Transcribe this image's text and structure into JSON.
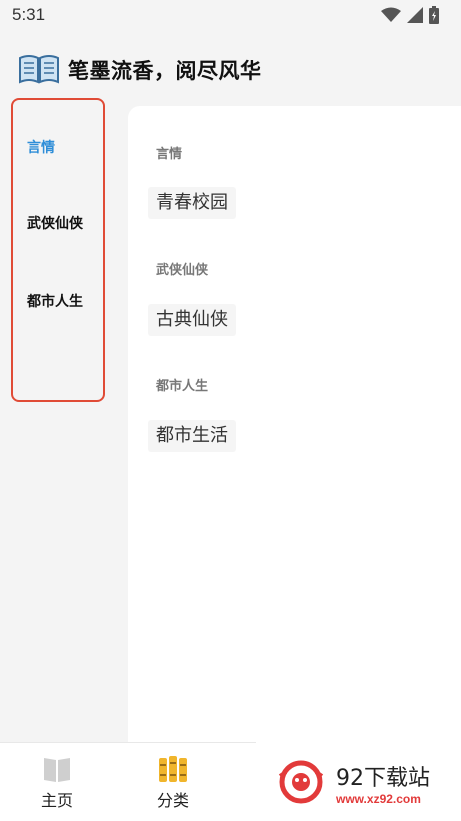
{
  "status_bar": {
    "time": "5:31"
  },
  "header": {
    "title": "笔墨流香，阅尽风华"
  },
  "sidebar": {
    "items": [
      {
        "label": "言情",
        "active": true
      },
      {
        "label": "武侠仙侠",
        "active": false
      },
      {
        "label": "都市人生",
        "active": false
      }
    ]
  },
  "content": {
    "sections": [
      {
        "title": "言情",
        "tags": [
          "青春校园"
        ]
      },
      {
        "title": "武侠仙侠",
        "tags": [
          "古典仙侠"
        ]
      },
      {
        "title": "都市人生",
        "tags": [
          "都市生活"
        ]
      }
    ]
  },
  "tabbar": {
    "tabs": [
      {
        "label": "主页",
        "icon": "book-icon"
      },
      {
        "label": "分类",
        "icon": "category-icon"
      }
    ]
  },
  "watermark": {
    "title": "92下载站",
    "url": "www.xz92.com"
  },
  "colors": {
    "active": "#2f8ed8",
    "highlight": "#e04b36"
  }
}
